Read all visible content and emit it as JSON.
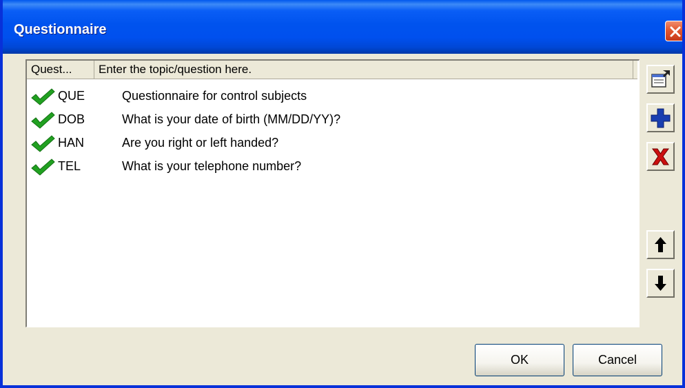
{
  "window": {
    "title": "Questionnaire",
    "title_color": "#0054e3",
    "close_icon": "close-icon"
  },
  "list": {
    "columns": [
      "Quest...",
      "Enter the topic/question here."
    ],
    "rows": [
      {
        "code": "QUE",
        "text": "Questionnaire for control subjects",
        "icon": "checkmark-icon"
      },
      {
        "code": "DOB",
        "text": "What is your date of birth (MM/DD/YY)?",
        "icon": "checkmark-icon"
      },
      {
        "code": "HAN",
        "text": "Are you right or left handed?",
        "icon": "checkmark-icon"
      },
      {
        "code": "TEL",
        "text": "What is your telephone number?",
        "icon": "checkmark-icon"
      }
    ]
  },
  "side_buttons": [
    {
      "icon": "properties-icon"
    },
    {
      "icon": "add-icon",
      "color": "#1a3fb0"
    },
    {
      "icon": "delete-icon",
      "color": "#cc1010"
    },
    {
      "icon": "move-up-icon"
    },
    {
      "icon": "move-down-icon"
    }
  ],
  "buttons": {
    "ok_label": "OK",
    "cancel_label": "Cancel"
  },
  "colors": {
    "check_green": "#21a121",
    "dialog_bg": "#ece9d8"
  }
}
